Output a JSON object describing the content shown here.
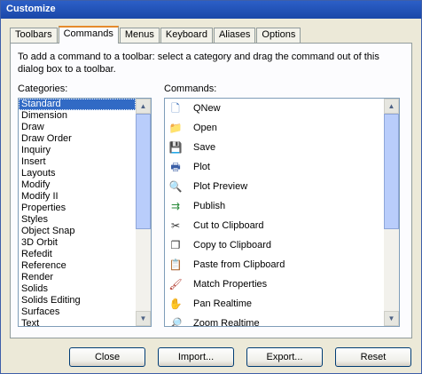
{
  "window": {
    "title": "Customize"
  },
  "tabs": [
    {
      "label": "Toolbars"
    },
    {
      "label": "Commands",
      "active": true
    },
    {
      "label": "Menus"
    },
    {
      "label": "Keyboard"
    },
    {
      "label": "Aliases"
    },
    {
      "label": "Options"
    }
  ],
  "instructions": "To add a command to a toolbar: select a category and drag the command out of this dialog box to a toolbar.",
  "categories": {
    "label": "Categories:",
    "selected": "Standard",
    "items": [
      "Standard",
      "Dimension",
      "Draw",
      "Draw Order",
      "Inquiry",
      "Insert",
      "Layouts",
      "Modify",
      "Modify II",
      "Properties",
      "Styles",
      "Object Snap",
      "3D Orbit",
      "Refedit",
      "Reference",
      "Render",
      "Solids",
      "Solids Editing",
      "Surfaces",
      "Text"
    ]
  },
  "commands": {
    "label": "Commands:",
    "items": [
      {
        "label": "QNew",
        "icon": "new-document-icon"
      },
      {
        "label": "Open",
        "icon": "folder-icon"
      },
      {
        "label": "Save",
        "icon": "floppy-icon"
      },
      {
        "label": "Plot",
        "icon": "printer-icon"
      },
      {
        "label": "Plot Preview",
        "icon": "print-preview-icon"
      },
      {
        "label": "Publish",
        "icon": "publish-icon"
      },
      {
        "label": "Cut to Clipboard",
        "icon": "scissors-icon"
      },
      {
        "label": "Copy to Clipboard",
        "icon": "copy-icon"
      },
      {
        "label": "Paste from Clipboard",
        "icon": "paste-icon"
      },
      {
        "label": "Match Properties",
        "icon": "paintbrush-icon"
      },
      {
        "label": "Pan Realtime",
        "icon": "hand-icon"
      },
      {
        "label": "Zoom Realtime",
        "icon": "zoom-icon"
      }
    ]
  },
  "buttons": {
    "close": "Close",
    "import": "Import...",
    "export": "Export...",
    "reset": "Reset"
  },
  "colors": {
    "selection": "#316ac5",
    "titlebar": "#1a47a8",
    "tab_accent": "#e68b2c",
    "dialog_bg": "#ece9d8"
  }
}
